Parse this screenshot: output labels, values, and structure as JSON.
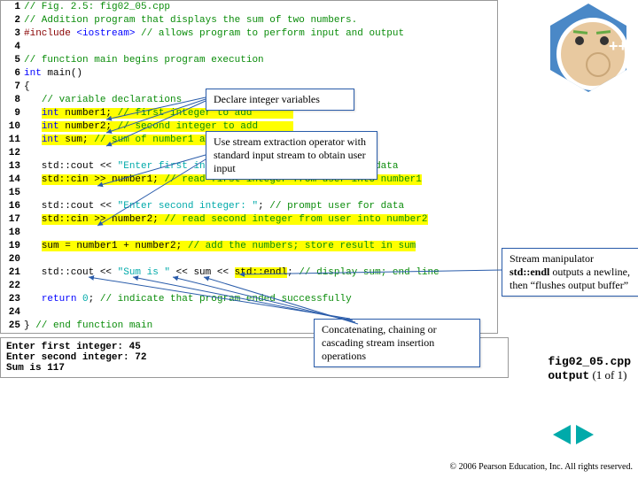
{
  "code": {
    "lines": [
      {
        "n": "1",
        "html": "<span class='comment'>// Fig. 2.5: fig02_05.cpp</span>"
      },
      {
        "n": "2",
        "html": "<span class='comment'>// Addition program that displays the sum of two numbers.</span>"
      },
      {
        "n": "3",
        "html": "<span class='pp'>#include</span> <span class='kw'>&lt;iostream&gt;</span> <span class='comment'>// allows program to perform input and output</span>"
      },
      {
        "n": "4",
        "html": ""
      },
      {
        "n": "5",
        "html": "<span class='comment'>// function main begins program execution</span>"
      },
      {
        "n": "6",
        "html": "<span class='kw'>int</span> main()"
      },
      {
        "n": "7",
        "html": "{"
      },
      {
        "n": "8",
        "html": "   <span class='comment'>// variable declarations</span>"
      },
      {
        "n": "9",
        "html": "   <span class='hl'><span class='kw'>int</span> number1; <span class='comment'>// first integer to add</span>       </span>"
      },
      {
        "n": "10",
        "html": "   <span class='hl'><span class='kw'>int</span> number2; <span class='comment'>// second integer to add</span>      </span>"
      },
      {
        "n": "11",
        "html": "   <span class='hl'><span class='kw'>int</span> sum; <span class='comment'>// sum of number1 and number2</span></span>"
      },
      {
        "n": "12",
        "html": ""
      },
      {
        "n": "13",
        "html": "   std::cout &lt;&lt; <span class='str'>\"Enter first integer: \"</span>; <span class='comment'>// prompt user for data</span>"
      },
      {
        "n": "14",
        "html": "   <span class='hl'>std::cin &gt;&gt; number1; <span class='comment'>// read first integer from user into number1</span></span>"
      },
      {
        "n": "15",
        "html": ""
      },
      {
        "n": "16",
        "html": "   std::cout &lt;&lt; <span class='str'>\"Enter second integer: \"</span>; <span class='comment'>// prompt user for data</span>"
      },
      {
        "n": "17",
        "html": "   <span class='hl'>std::cin &gt;&gt; number2; <span class='comment'>// read second integer from user into number2</span></span>"
      },
      {
        "n": "18",
        "html": ""
      },
      {
        "n": "19",
        "html": "   <span class='hl'>sum = number1 + number2; <span class='comment'>// add the numbers; store result in sum</span></span>"
      },
      {
        "n": "20",
        "html": ""
      },
      {
        "n": "21",
        "html": "   std::cout &lt;&lt; <span class='str'>\"Sum is \"</span> &lt;&lt; sum &lt;&lt; <span class='hl'>std::endl</span>; <span class='comment'>// display sum; end line</span>"
      },
      {
        "n": "22",
        "html": ""
      },
      {
        "n": "23",
        "html": "   <span class='kw'>return</span> <span class='str'>0</span>; <span class='comment'>// indicate that program ended successfully</span>"
      },
      {
        "n": "24",
        "html": ""
      },
      {
        "n": "25",
        "html": "} <span class='comment'>// end function main</span>"
      }
    ]
  },
  "output": "Enter first integer: 45\nEnter second integer: 72\nSum is 117",
  "callouts": {
    "c1": "Declare integer variables",
    "c2": "Use stream extraction operator with standard input stream to obtain user input",
    "c3": "Stream manipulator <span class='bold'>std::endl</span> outputs a newline, then “flushes output buffer”",
    "c4": "Concatenating, chaining or cascading stream insertion operations"
  },
  "file_label": {
    "name": "fig02_05.cpp",
    "out": "output",
    "page": " (1 of 1)"
  },
  "logo": {
    "plusplus": "++"
  },
  "copyright": "© 2006 Pearson Education,\nInc. All rights reserved."
}
